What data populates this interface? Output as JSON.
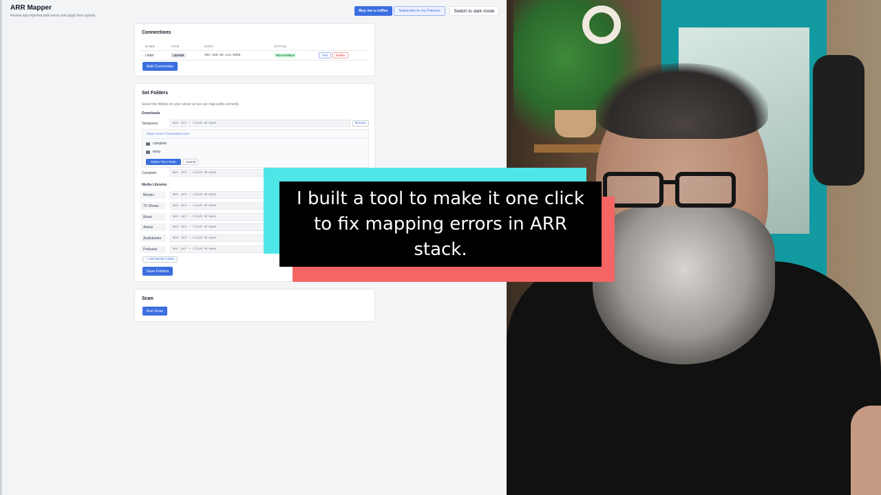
{
  "app": {
    "title": "ARR Mapper",
    "subtitle": "Review app-reported path errors and apply fixes quickly.",
    "buttons": {
      "coffee": "Buy me a coffee",
      "patreon": "Subscribe to my Patreon",
      "dark_mode": "Switch to dark mode"
    }
  },
  "connections": {
    "title": "Connections",
    "columns": [
      "NAME",
      "TYPE",
      "HOST",
      "STATUS"
    ],
    "rows": [
      {
        "name": "Lidarr",
        "type": "LIDARR",
        "host": "192.168.88.111:8686",
        "status": "REACHABLE",
        "test_label": "Test",
        "delete_label": "Delete"
      }
    ],
    "add_button": "Add Connection"
  },
  "folders": {
    "title": "Set Folders",
    "description": "Select the folders on your server so we can map paths correctly.",
    "downloads_heading": "Downloads",
    "temporary_label": "Temporary",
    "temporary_value": "Not set — click Browse",
    "browse_label": "Browse",
    "browser": {
      "path": "/mnt/user/transmission",
      "items": [
        "complete",
        "temp"
      ],
      "select_label": "Select This Folder",
      "cancel_label": "Cancel"
    },
    "complete_label": "Complete",
    "complete_value": "Not set — click Browse",
    "libraries_heading": "Media Libraries",
    "libraries": [
      {
        "name": "Movies",
        "value": "Not set — click Browse"
      },
      {
        "name": "TV Shows",
        "value": "Not set — click Browse"
      },
      {
        "name": "Music",
        "value": "Not set — click Browse"
      },
      {
        "name": "Anime",
        "value": "Not set — click Browse"
      },
      {
        "name": "Audiobooks",
        "value": "Not set — click Browse"
      },
      {
        "name": "Podcasts",
        "value": "Not set — click Browse"
      }
    ],
    "add_media_label": "+ Add Media Folder",
    "save_label": "Save Folders"
  },
  "scan": {
    "title": "Scan",
    "run_label": "Run Scan"
  },
  "caption": {
    "line1": "I built a tool to make it one click",
    "line2": "to fix mapping errors in ARR stack."
  },
  "colors": {
    "accent": "#3b6fe0",
    "caption_cyan": "#4ee6e6",
    "caption_red": "#f46564",
    "reachable_green": "#15803d"
  }
}
